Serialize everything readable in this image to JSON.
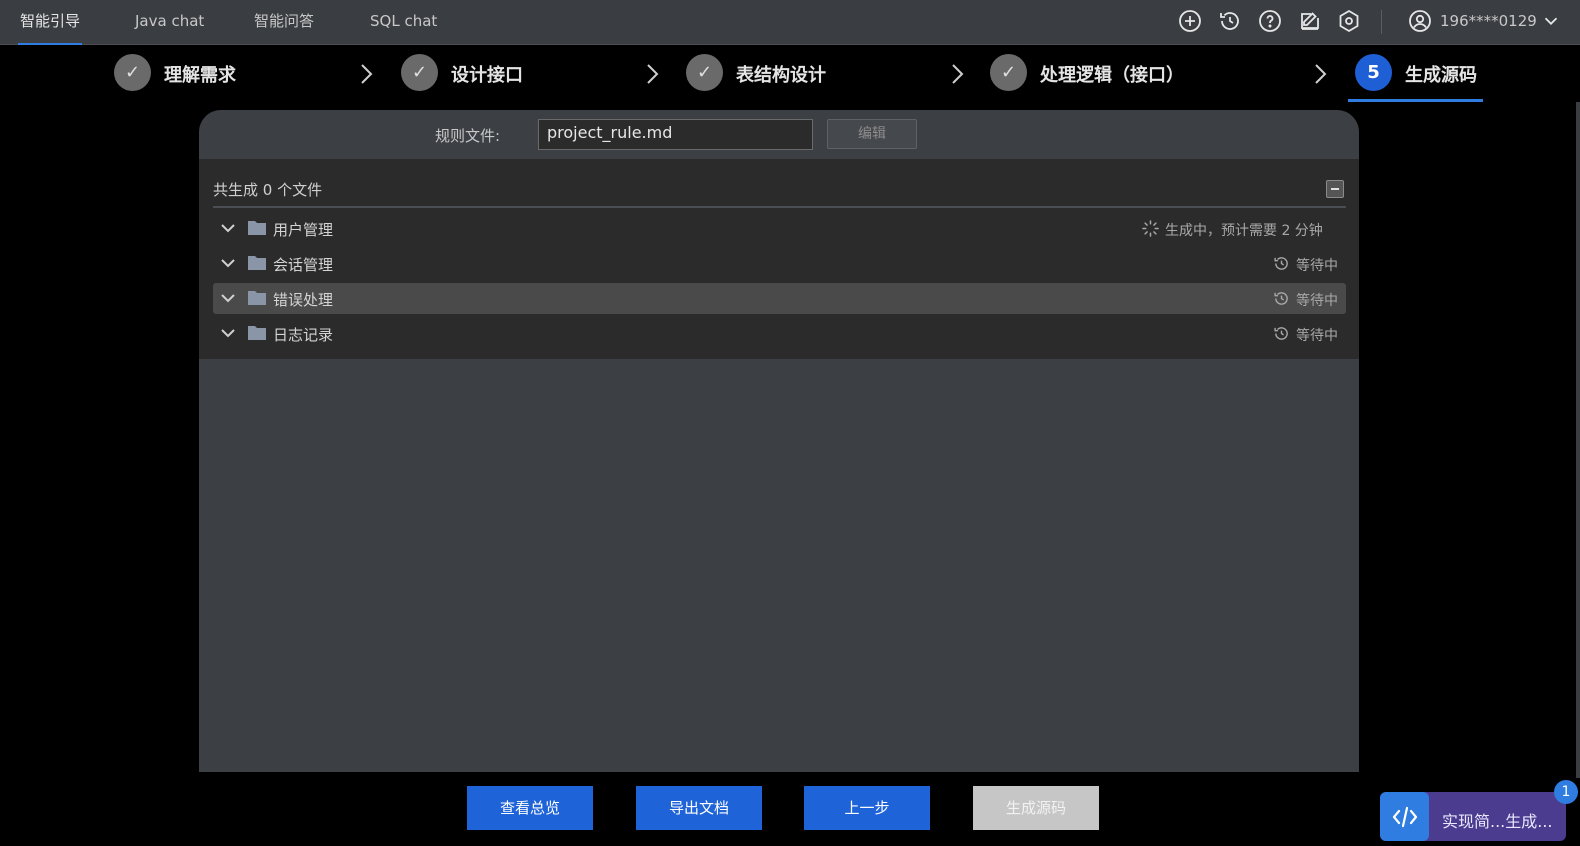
{
  "nav": {
    "tabs": [
      {
        "label": "智能引导",
        "active": true
      },
      {
        "label": "Java chat",
        "active": false
      },
      {
        "label": "智能问答",
        "active": false
      },
      {
        "label": "SQL chat",
        "active": false
      }
    ],
    "toolbar_icons": [
      "add-circle-icon",
      "history-icon",
      "help-icon",
      "edit-icon",
      "settings-icon"
    ],
    "user": {
      "name": "196****0129",
      "icon": "user-circle-icon"
    }
  },
  "steps": [
    {
      "number": "✓",
      "label": "理解需求",
      "state": "done"
    },
    {
      "number": "✓",
      "label": "设计接口",
      "state": "done"
    },
    {
      "number": "✓",
      "label": "表结构设计",
      "state": "done"
    },
    {
      "number": "✓",
      "label": "处理逻辑（接口）",
      "state": "done"
    },
    {
      "number": "5",
      "label": "生成源码",
      "state": "current"
    }
  ],
  "rule": {
    "label": "规则文件:",
    "value": "project_rule.md",
    "edit_label": "编辑"
  },
  "files": {
    "count_text": "共生成 0 个文件",
    "rows": [
      {
        "name": "用户管理",
        "status": "生成中，预计需要 2 分钟",
        "status_icon": "spinner-icon"
      },
      {
        "name": "会话管理",
        "status": "等待中",
        "status_icon": "history-icon"
      },
      {
        "name": "错误处理",
        "status": "等待中",
        "status_icon": "history-icon"
      },
      {
        "name": "日志记录",
        "status": "等待中",
        "status_icon": "history-icon"
      }
    ]
  },
  "buttons": {
    "overview": "查看总览",
    "export": "导出文档",
    "prev": "上一步",
    "generate": "生成源码"
  },
  "assistant": {
    "text": "实现简...生成...",
    "badge": "1"
  },
  "colors": {
    "accent": "#2f7de1",
    "primary_button": "#1f63d8",
    "disabled_button": "#c6c6c6",
    "assistant": "#4b3c8f"
  }
}
